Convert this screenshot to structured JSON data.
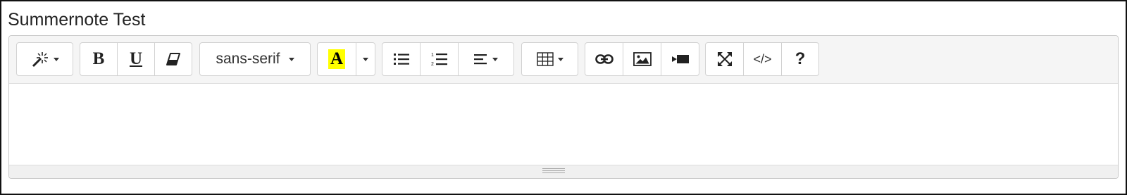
{
  "page": {
    "title": "Summernote Test"
  },
  "toolbar": {
    "style_icon": "magic-wand-icon",
    "bold_label": "B",
    "underline_label": "U",
    "clear_icon": "eraser-icon",
    "font_name": "sans-serif",
    "color_label": "A",
    "color_highlight": "#ffff00",
    "unordered_list_icon": "unordered-list-icon",
    "ordered_list_icon": "ordered-list-icon",
    "paragraph_icon": "align-left-icon",
    "table_icon": "table-icon",
    "link_icon": "link-icon",
    "picture_icon": "picture-icon",
    "video_icon": "video-icon",
    "fullscreen_icon": "fullscreen-icon",
    "codeview_label": "</>",
    "help_label": "?"
  },
  "editor": {
    "content": ""
  },
  "statusbar": {
    "resize_icon": "resize-grip-icon"
  }
}
